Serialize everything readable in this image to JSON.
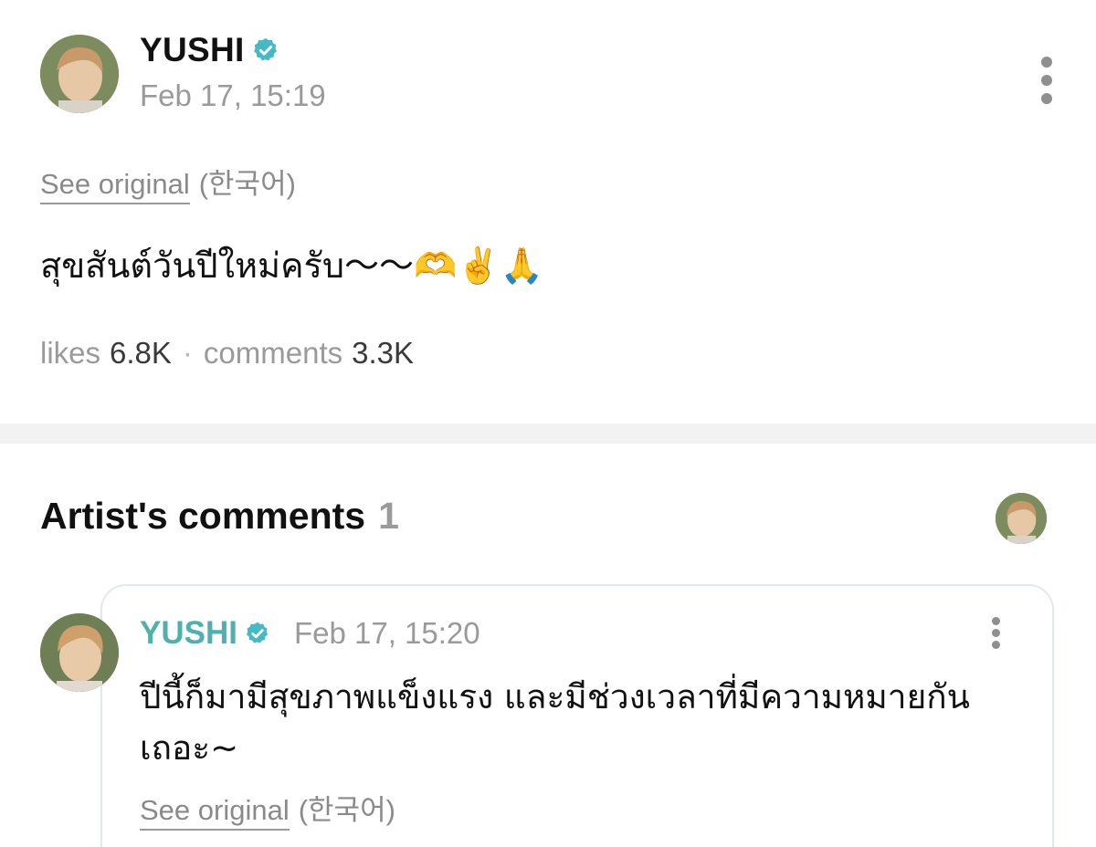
{
  "post": {
    "author": "YUSHI",
    "verified": true,
    "date": "Feb 17, 15:19",
    "see_original": "See original",
    "original_language": "(한국어)",
    "body": "สุขสันต์วันปีใหม่ครับ～～🫶✌️🙏",
    "likes_label": "likes",
    "likes_count": "6.8K",
    "separator": "·",
    "comments_label": "comments",
    "comments_count": "3.3K"
  },
  "artist_comments": {
    "title": "Artist's comments",
    "count": "1",
    "comments": [
      {
        "author": "YUSHI",
        "verified": true,
        "date": "Feb 17, 15:20",
        "text": "ปีนี้ก็มามีสุขภาพแข็งแรง และมีช่วงเวลาที่มีความหมายกันเถอะ~",
        "see_original": "See original",
        "original_language": "(한국어)"
      }
    ]
  },
  "icons": {
    "verified": "verified-check-badge-icon",
    "more": "more-vertical-icon"
  },
  "colors": {
    "verified_badge": "#45b9c4",
    "comment_author": "#4fb0ac",
    "muted_text": "#9a9a9a",
    "divider": "#f2f2f2"
  }
}
